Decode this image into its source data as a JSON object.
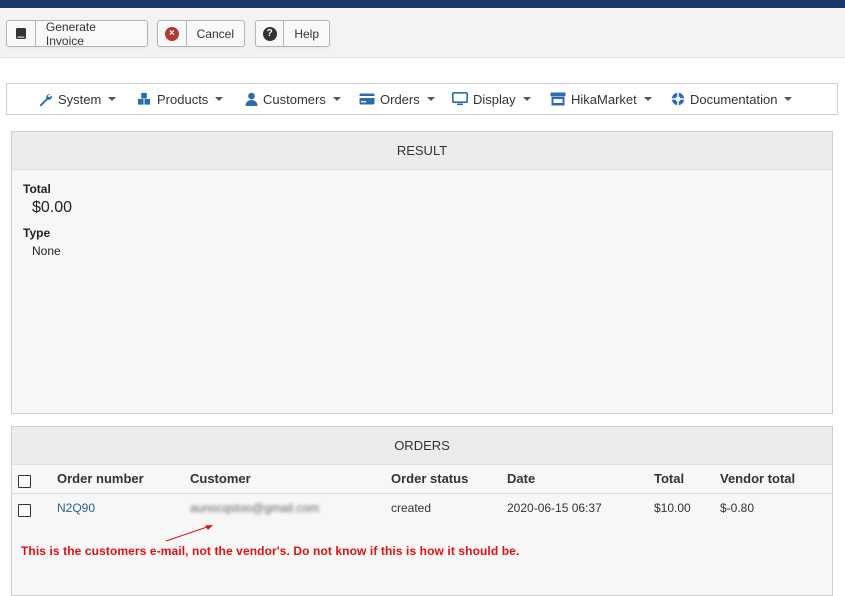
{
  "toolbar": {
    "generate_label": "Generate Invoice",
    "cancel_label": "Cancel",
    "help_label": "Help"
  },
  "menu": [
    {
      "label": "System",
      "icon": "wrench-icon"
    },
    {
      "label": "Products",
      "icon": "cubes-icon"
    },
    {
      "label": "Customers",
      "icon": "user-icon"
    },
    {
      "label": "Orders",
      "icon": "credit-card-icon"
    },
    {
      "label": "Display",
      "icon": "monitor-icon"
    },
    {
      "label": "HikaMarket",
      "icon": "store-icon"
    },
    {
      "label": "Documentation",
      "icon": "lifebuoy-icon"
    }
  ],
  "result": {
    "title": "RESULT",
    "total_label": "Total",
    "total_value": "$0.00",
    "type_label": "Type",
    "type_value": "None"
  },
  "orders": {
    "title": "ORDERS",
    "columns": [
      "Order number",
      "Customer",
      "Order status",
      "Date",
      "Total",
      "Vendor total"
    ],
    "rows": [
      {
        "order_number": "N2Q90",
        "customer": "aunocqstoo@gmail.com",
        "status": "created",
        "date": "2020-06-15 06:37",
        "total": "$10.00",
        "vendor_total": "$-0.80"
      }
    ],
    "annotation": "This is the customers e-mail, not the vendor's. Do not know if this is how it should be."
  },
  "colors": {
    "topbar": "#1a3867",
    "menu_icon": "#2b6cb0",
    "link": "#2a6496",
    "annotation": "#e01010",
    "cancel_icon": "#b03a2e"
  }
}
